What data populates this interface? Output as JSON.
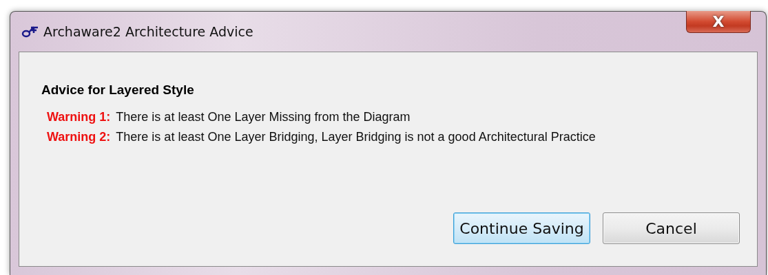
{
  "window": {
    "title": "Archaware2 Architecture Advice",
    "close_label": "X"
  },
  "heading": "Advice for Layered Style",
  "warnings": [
    {
      "label": "Warning 1:",
      "text": "There is at least One Layer Missing from the Diagram"
    },
    {
      "label": "Warning 2:",
      "text": "There is at least One Layer Bridging, Layer Bridging is not a good Architectural Practice"
    }
  ],
  "buttons": [
    {
      "label": "Continue Saving",
      "focused": true
    },
    {
      "label": "Cancel",
      "focused": false
    }
  ]
}
